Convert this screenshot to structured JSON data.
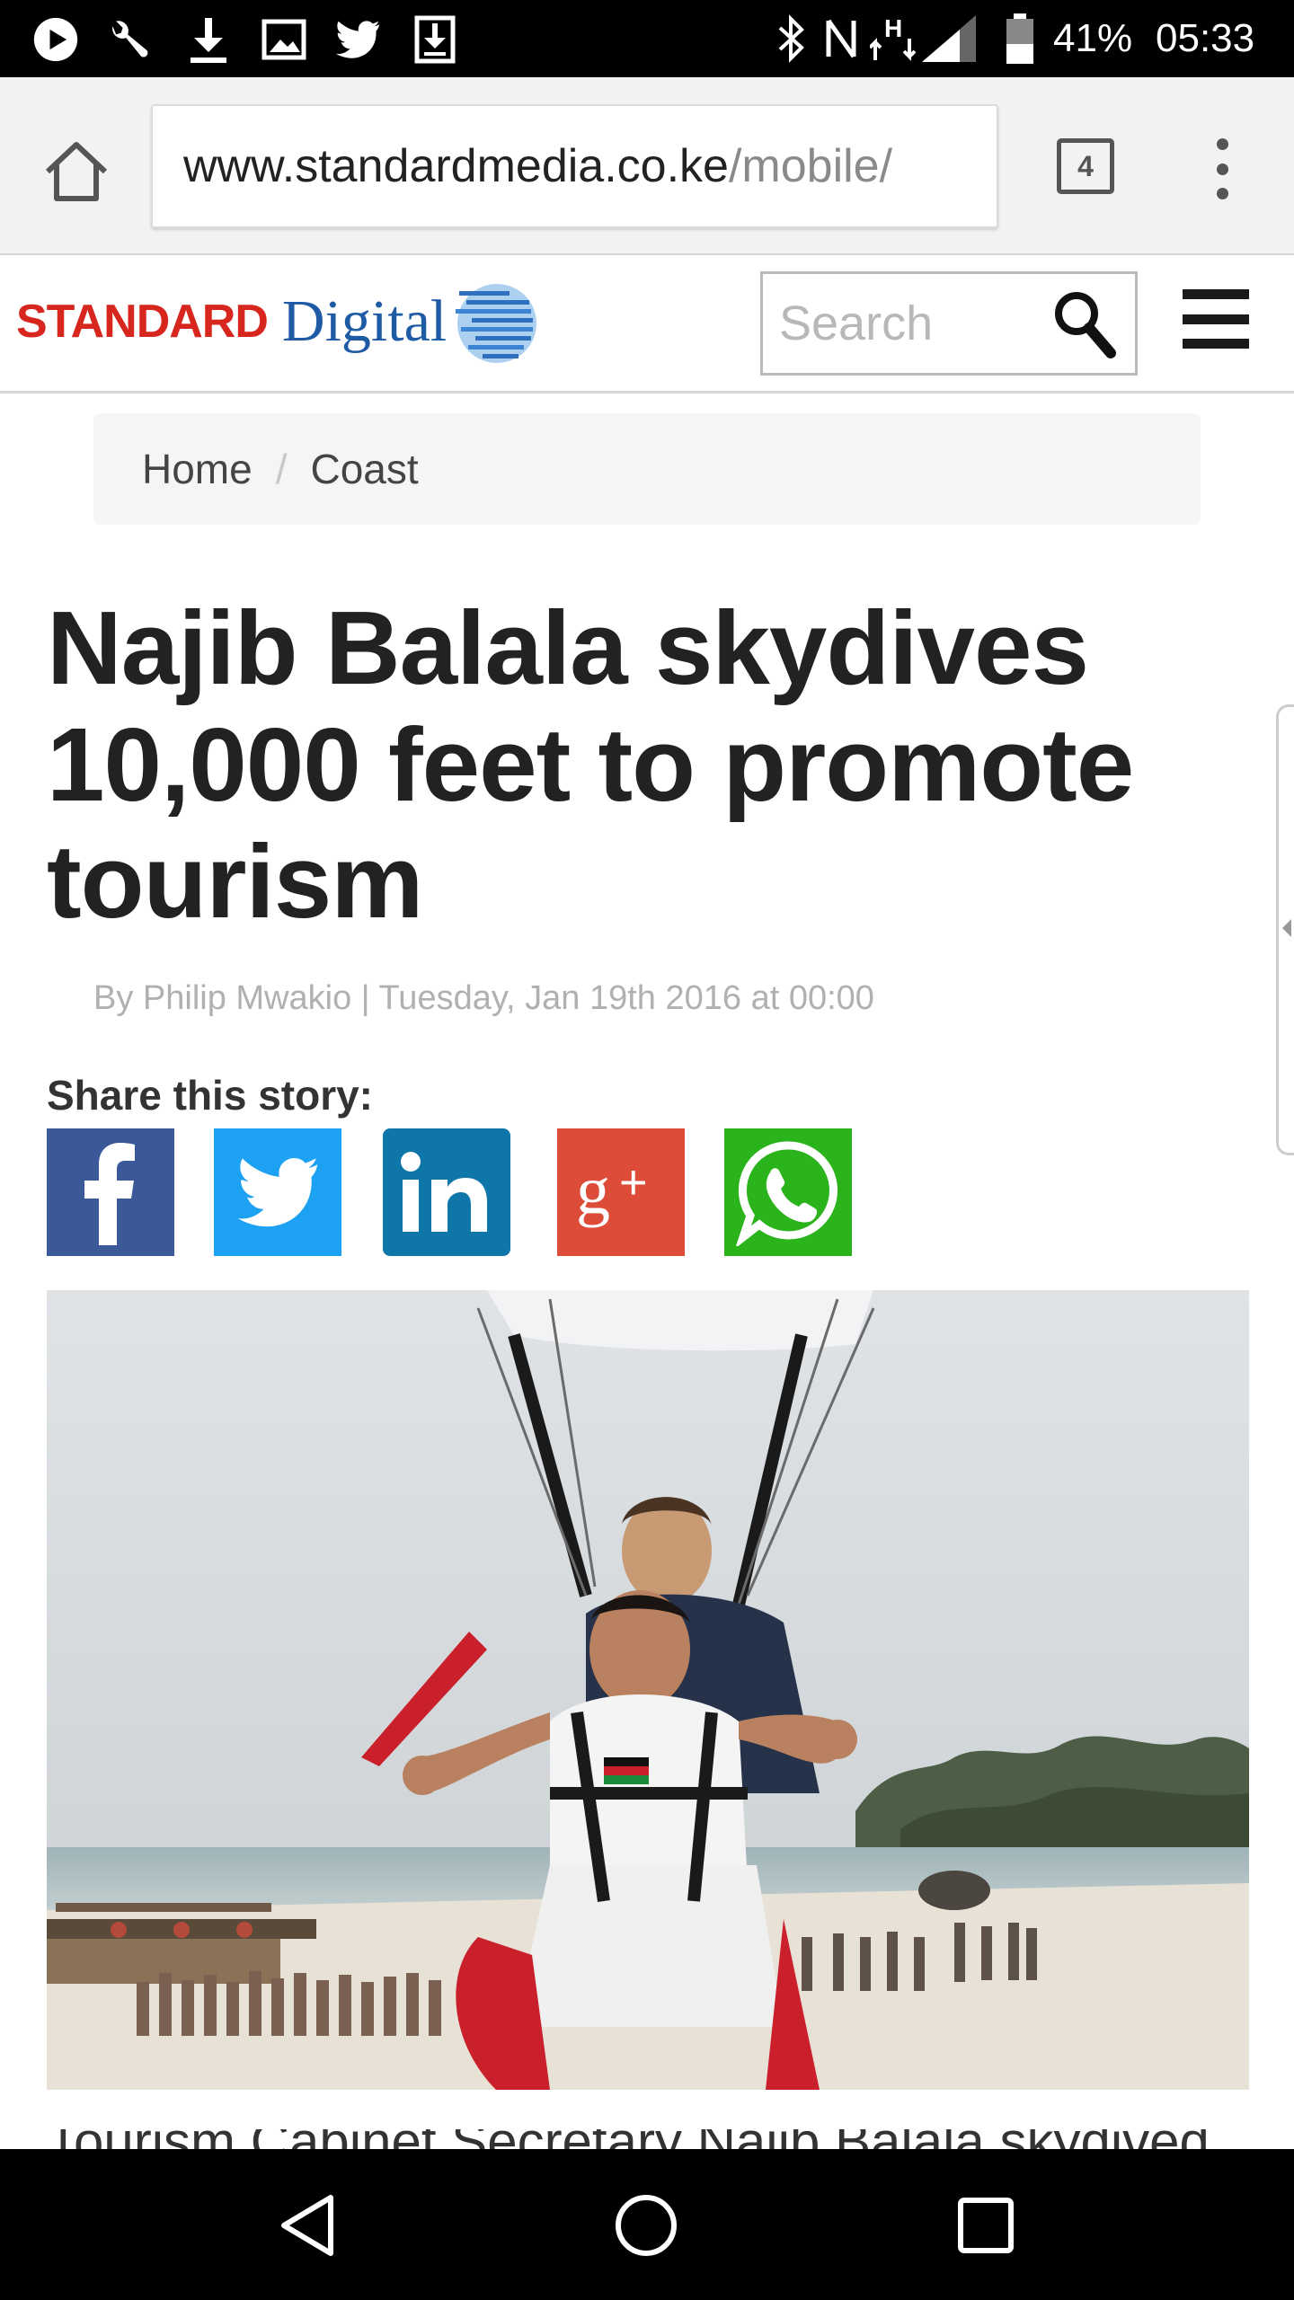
{
  "status_bar": {
    "battery": "41%",
    "time": "05:33",
    "left_icons": [
      "play-icon",
      "wrench-icon",
      "download-icon",
      "image-icon",
      "twitter-icon",
      "download-box-icon"
    ],
    "right_icons": [
      "bluetooth-icon",
      "nfc-icon",
      "h-data-icon",
      "signal-icon",
      "battery-icon"
    ]
  },
  "browser": {
    "url_host": "www.standardmedia.co.ke",
    "url_path": "/mobile/",
    "tab_count": "4"
  },
  "site": {
    "logo_part1": "STANDARD",
    "logo_part2": "Digital",
    "search_placeholder": "Search"
  },
  "breadcrumb": {
    "items": [
      "Home",
      "Coast"
    ],
    "separator": "/"
  },
  "article": {
    "headline": "Najib Balala skydives 10,000 feet to promote tourism",
    "byline": "By Philip Mwakio | Tuesday, Jan 19th 2016 at 00:00",
    "share_label": "Share this story:",
    "share_buttons": [
      "facebook",
      "twitter",
      "linkedin",
      "google-plus",
      "whatsapp"
    ],
    "body_start": "Tourism Cabinet Secretary Najib Balala skydived"
  },
  "colors": {
    "brand_red": "#d7261e",
    "brand_blue": "#1f5aa5",
    "facebook": "#3b5998",
    "twitter": "#1da1f2",
    "linkedin": "#0e76a8",
    "google_plus": "#dd4b39",
    "whatsapp": "#2ab31b"
  }
}
